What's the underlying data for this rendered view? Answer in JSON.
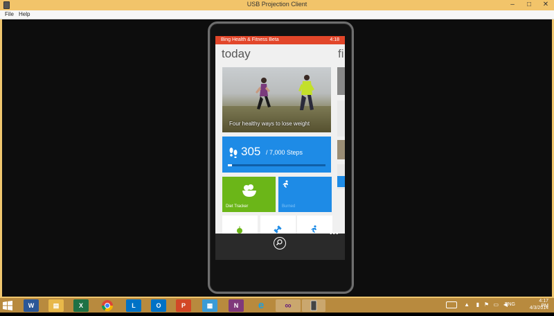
{
  "window": {
    "title": "USB Projection Client",
    "min_glyph": "–",
    "max_glyph": "□",
    "close_glyph": "✕"
  },
  "menu": {
    "file": "File",
    "help": "Help"
  },
  "phone": {
    "status": {
      "app_name": "Bing Health & Fitness Beta",
      "time": "4:18"
    },
    "heading": "today",
    "heading_next": "fi",
    "hero": {
      "caption": "Four healthy ways to lose weight"
    },
    "steps": {
      "count": "305",
      "goal_text": "/ 7,000 Steps",
      "progress_fraction": 0.04
    },
    "diet": {
      "label": "Diet Tracker"
    },
    "burned": {
      "label": "Burned"
    },
    "more_glyph": "•••"
  },
  "taskbar": {
    "apps": [
      "Windows",
      "Word",
      "File Explorer",
      "Excel",
      "Chrome",
      "Lync",
      "Outlook",
      "PowerPoint",
      "Photos",
      "OneNote",
      "Internet Explorer",
      "Visual Studio",
      "USB Projection Client"
    ],
    "lang": "ENG",
    "time": "4:17 PM",
    "date": "4/3/2014"
  },
  "colors": {
    "titlebar": "#f2c46a",
    "statusbar": "#e2462a",
    "tile_blue": "#1e8be6",
    "tile_green": "#6bb618",
    "taskbar": "#b88a3e"
  }
}
